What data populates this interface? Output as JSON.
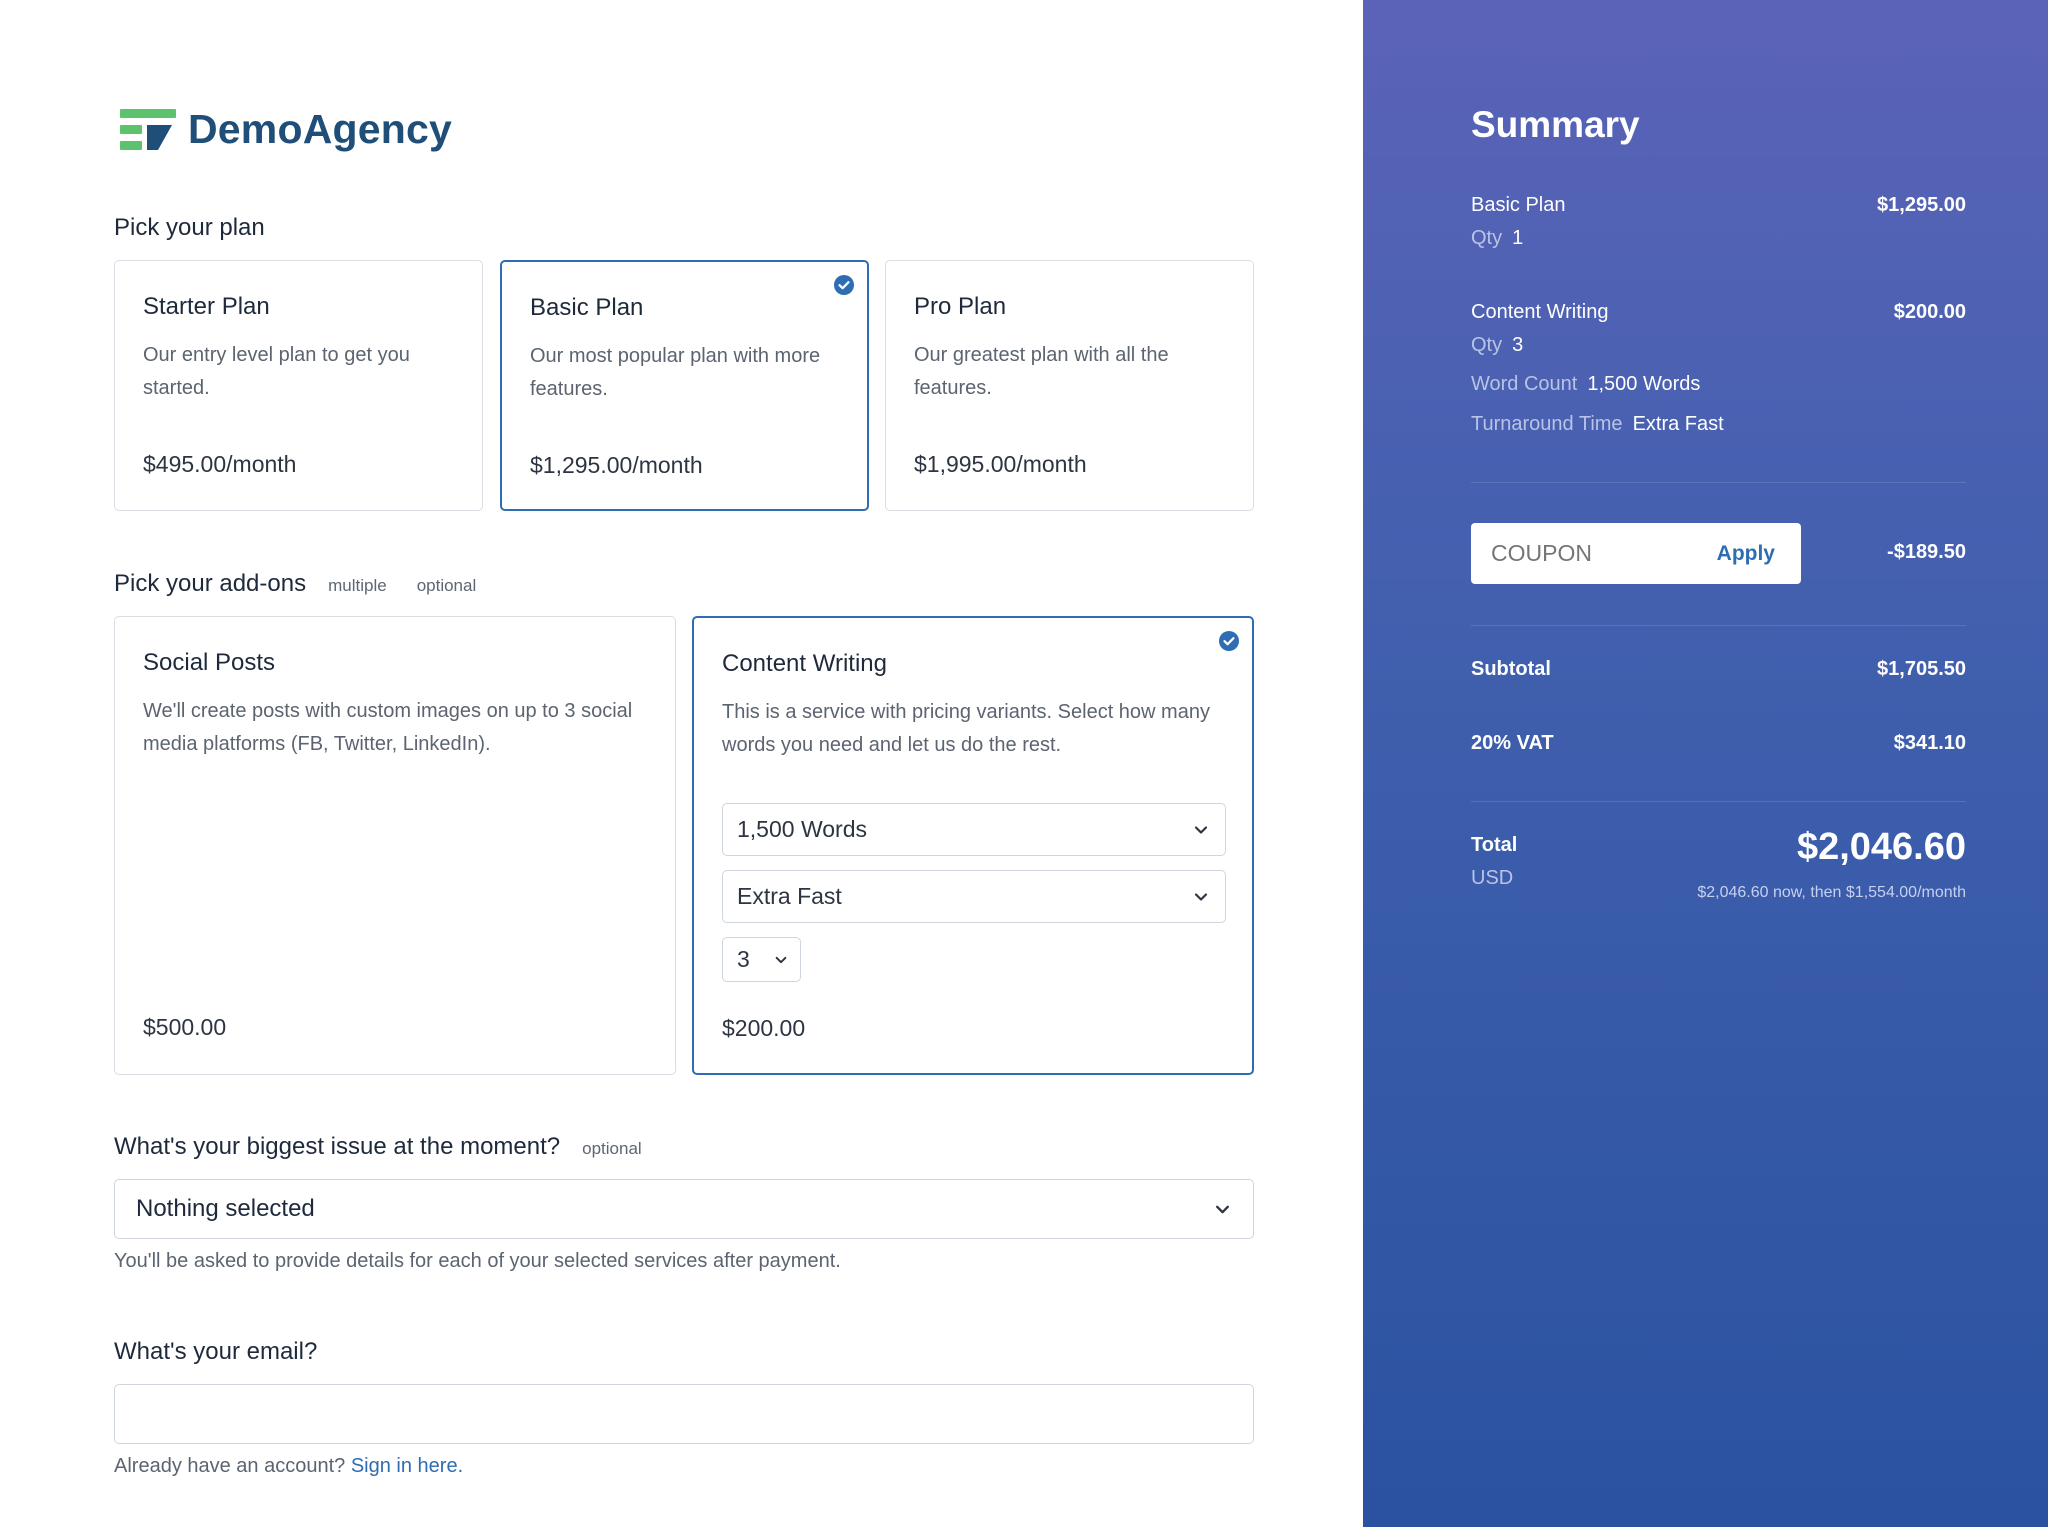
{
  "brand": {
    "name": "DemoAgency"
  },
  "plans_section": {
    "title": "Pick your plan",
    "plans": [
      {
        "title": "Starter Plan",
        "description": "Our entry level plan to get you started.",
        "price": "$495.00/month",
        "selected": false
      },
      {
        "title": "Basic Plan",
        "description": "Our most popular plan with more features.",
        "price": "$1,295.00/month",
        "selected": true
      },
      {
        "title": "Pro Plan",
        "description": "Our greatest plan with all the features.",
        "price": "$1,995.00/month",
        "selected": false
      }
    ]
  },
  "addons_section": {
    "title": "Pick your add-ons",
    "tag_multiple": "multiple",
    "tag_optional": "optional",
    "addons": [
      {
        "title": "Social Posts",
        "description": "We'll create posts with custom images on up to 3 social media platforms (FB, Twitter, LinkedIn).",
        "price": "$500.00",
        "selected": false
      },
      {
        "title": "Content Writing",
        "description": "This is a service with pricing variants. Select how many words you need and let us do the rest.",
        "price": "$200.00",
        "selected": true,
        "word_count": "1,500 Words",
        "turnaround": "Extra Fast",
        "quantity": "3"
      }
    ]
  },
  "issue_section": {
    "title": "What's your biggest issue at the moment?",
    "tag_optional": "optional",
    "selected": "Nothing selected",
    "helper": "You'll be asked to provide details for each of your selected services after payment."
  },
  "email_section": {
    "title": "What's your email?",
    "value": "",
    "helper_prefix": "Already have an account?",
    "sign_in_link": "Sign in here."
  },
  "summary": {
    "title": "Summary",
    "items": [
      {
        "name": "Basic Plan",
        "amount": "$1,295.00",
        "qty_label": "Qty",
        "qty": "1"
      },
      {
        "name": "Content Writing",
        "amount": "$200.00",
        "qty_label": "Qty",
        "qty": "3",
        "word_count_label": "Word Count",
        "word_count": "1,500 Words",
        "turnaround_label": "Turnaround Time",
        "turnaround": "Extra Fast"
      }
    ],
    "coupon_placeholder": "COUPON",
    "coupon_apply": "Apply",
    "discount": "-$189.50",
    "subtotal_label": "Subtotal",
    "subtotal": "$1,705.50",
    "vat_label": "20% VAT",
    "vat": "$341.10",
    "total_label": "Total",
    "currency": "USD",
    "total": "$2,046.60",
    "total_note": "$2,046.60 now, then $1,554.00/month"
  },
  "icons": {
    "logo": "logo-icon",
    "check": "check-circle-icon",
    "chevron": "chevron-down-icon"
  },
  "colors": {
    "accent": "#2e6db4",
    "brand_text": "#1f4e79",
    "logo_green": "#5cc26e",
    "panel_top": "#5b63b8",
    "panel_bottom": "#2a52a0"
  }
}
